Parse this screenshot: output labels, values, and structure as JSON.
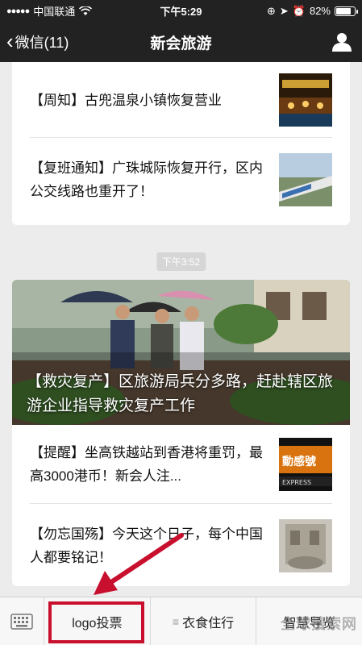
{
  "status_bar": {
    "carrier": "中国联通",
    "time": "下午5:29",
    "battery": "82%",
    "battery_level": 0.82
  },
  "nav": {
    "back_label": "微信(11)",
    "title": "新会旅游"
  },
  "articles_top": [
    {
      "text": "【周知】古兜温泉小镇恢复营业"
    },
    {
      "text": "【复班通知】广珠城际恢复开行，区内公交线路也重开了！"
    }
  ],
  "timestamp": "下午3:52",
  "hero": {
    "caption": "【救灾复产】区旅游局兵分多路，赶赴辖区旅游企业指导救灾复产工作"
  },
  "articles_bottom": [
    {
      "text": "【提醒】坐高铁越站到香港将重罚，最高3000港币！新会人注..."
    },
    {
      "text": "【勿忘国殇】今天这个日子，每个中国人都要铭记！"
    }
  ],
  "menu": {
    "items": [
      "logo投票",
      "衣食住行",
      "智慧导览"
    ]
  },
  "watermark": "全球搜索网",
  "colors": {
    "dark_bar": "#222222",
    "highlight": "#c8102e"
  }
}
